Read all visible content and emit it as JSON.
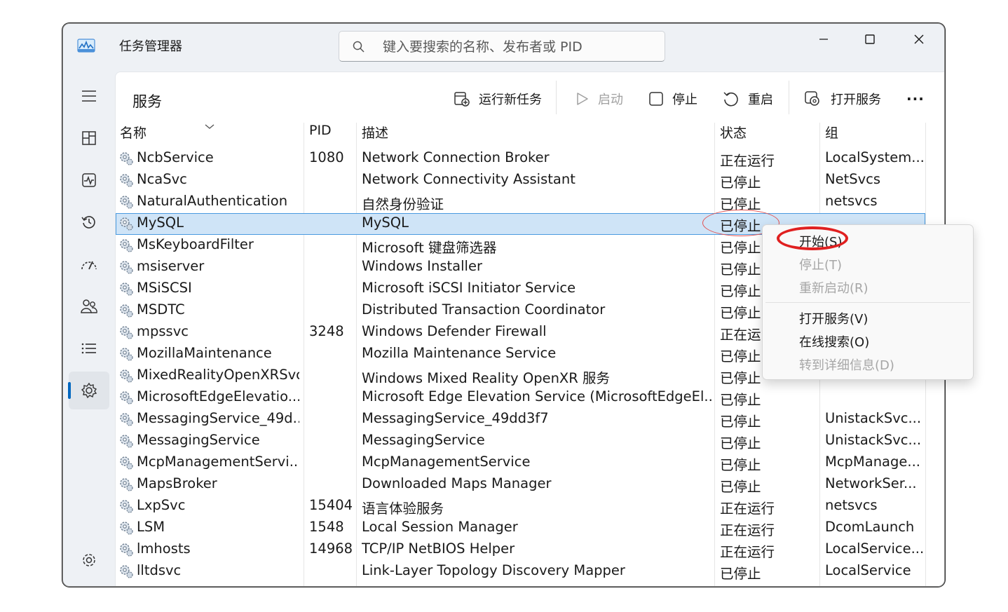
{
  "window": {
    "title": "任务管理器"
  },
  "search": {
    "placeholder": "键入要搜索的名称、发布者或 PID"
  },
  "page": {
    "title": "服务"
  },
  "toolbar": {
    "run_new_task": "运行新任务",
    "start": "启动",
    "stop": "停止",
    "restart": "重启",
    "open_services": "打开服务",
    "more": "···"
  },
  "columns": {
    "name": "名称",
    "pid": "PID",
    "desc": "描述",
    "status": "状态",
    "group": "组"
  },
  "rows": [
    {
      "name": "NcbService",
      "pid": "1080",
      "desc": "Network Connection Broker",
      "status": "正在运行",
      "group": "LocalSystem..."
    },
    {
      "name": "NcaSvc",
      "pid": "",
      "desc": "Network Connectivity Assistant",
      "status": "已停止",
      "group": "NetSvcs"
    },
    {
      "name": "NaturalAuthentication",
      "pid": "",
      "desc": "自然身份验证",
      "status": "已停止",
      "group": "netsvcs"
    },
    {
      "name": "MySQL",
      "pid": "",
      "desc": "MySQL",
      "status": "已停止",
      "group": ""
    },
    {
      "name": "MsKeyboardFilter",
      "pid": "",
      "desc": "Microsoft 键盘筛选器",
      "status": "已停止",
      "group": ""
    },
    {
      "name": "msiserver",
      "pid": "",
      "desc": "Windows Installer",
      "status": "已停止",
      "group": ""
    },
    {
      "name": "MSiSCSI",
      "pid": "",
      "desc": "Microsoft iSCSI Initiator Service",
      "status": "已停止",
      "group": ""
    },
    {
      "name": "MSDTC",
      "pid": "",
      "desc": "Distributed Transaction Coordinator",
      "status": "已停止",
      "group": ""
    },
    {
      "name": "mpssvc",
      "pid": "3248",
      "desc": "Windows Defender Firewall",
      "status": "正在运",
      "group": ""
    },
    {
      "name": "MozillaMaintenance",
      "pid": "",
      "desc": "Mozilla Maintenance Service",
      "status": "已停止",
      "group": ""
    },
    {
      "name": "MixedRealityOpenXRSvc",
      "pid": "",
      "desc": "Windows Mixed Reality OpenXR 服务",
      "status": "已停止",
      "group": ""
    },
    {
      "name": "MicrosoftEdgeElevatio...",
      "pid": "",
      "desc": "Microsoft Edge Elevation Service (MicrosoftEdgeEl...",
      "status": "已停止",
      "group": ""
    },
    {
      "name": "MessagingService_49d...",
      "pid": "",
      "desc": "MessagingService_49dd3f7",
      "status": "已停止",
      "group": "UnistackSvc..."
    },
    {
      "name": "MessagingService",
      "pid": "",
      "desc": "MessagingService",
      "status": "已停止",
      "group": "UnistackSvc..."
    },
    {
      "name": "McpManagementServi...",
      "pid": "",
      "desc": "McpManagementService",
      "status": "已停止",
      "group": "McpManage..."
    },
    {
      "name": "MapsBroker",
      "pid": "",
      "desc": "Downloaded Maps Manager",
      "status": "已停止",
      "group": "NetworkSer..."
    },
    {
      "name": "LxpSvc",
      "pid": "15404",
      "desc": "语言体验服务",
      "status": "正在运行",
      "group": "netsvcs"
    },
    {
      "name": "LSM",
      "pid": "1548",
      "desc": "Local Session Manager",
      "status": "正在运行",
      "group": "DcomLaunch"
    },
    {
      "name": "lmhosts",
      "pid": "14968",
      "desc": "TCP/IP NetBIOS Helper",
      "status": "正在运行",
      "group": "LocalService..."
    },
    {
      "name": "lltdsvc",
      "pid": "",
      "desc": "Link-Layer Topology Discovery Mapper",
      "status": "已停止",
      "group": "LocalService"
    }
  ],
  "context_menu": {
    "items": [
      {
        "label": "开始(S)"
      },
      {
        "label": "停止(T)"
      },
      {
        "label": "重新启动(R)"
      },
      {
        "label": "打开服务(V)"
      },
      {
        "label": "在线搜索(O)"
      },
      {
        "label": "转到详细信息(D)"
      }
    ]
  },
  "colors": {
    "accent": "#0067c0",
    "selection": "#cfe4f7",
    "annotation": "#e02020"
  }
}
